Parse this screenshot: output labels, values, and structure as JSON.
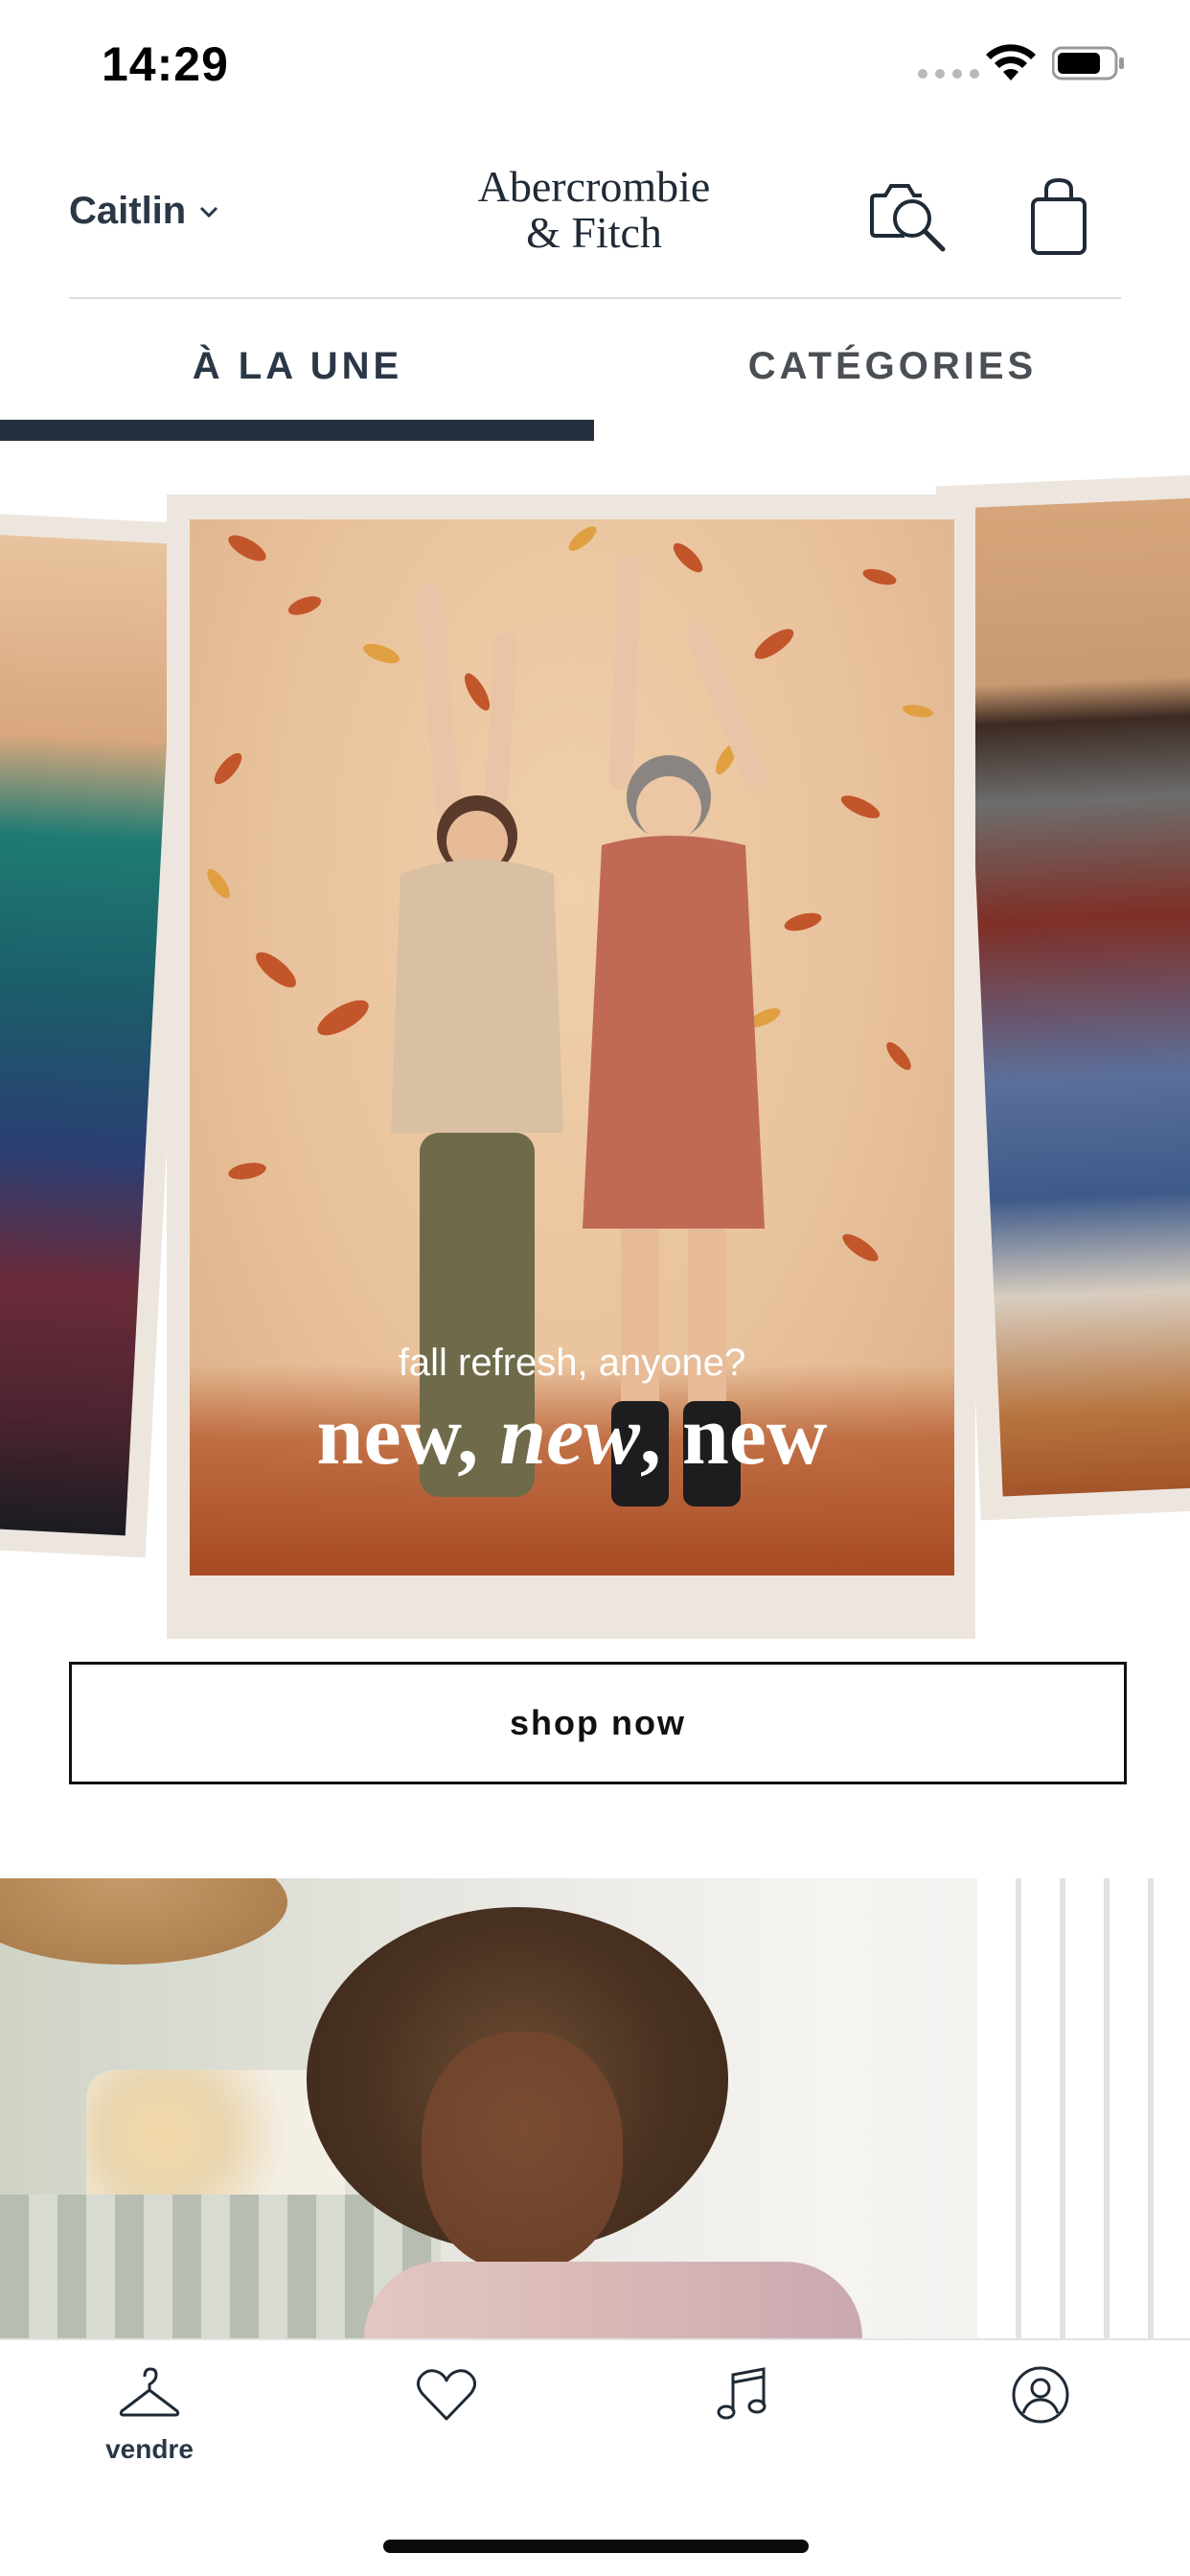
{
  "status_bar": {
    "time": "14:29",
    "icons": [
      "signal-icon",
      "wifi-icon",
      "battery-icon"
    ]
  },
  "header": {
    "user_name": "Caitlin",
    "logo_line1": "Abercrombie",
    "logo_line2": "& Fitch",
    "icons": [
      "chevron-down-icon",
      "visual-search-icon",
      "shopping-bag-icon"
    ]
  },
  "tabs": [
    {
      "label": "À LA UNE",
      "active": true
    },
    {
      "label": "CATÉGORIES",
      "active": false
    }
  ],
  "promo": {
    "subtitle": "fall refresh, anyone?",
    "title_part1": "new, ",
    "title_part2": "new",
    "title_part3": ", new",
    "button_label": "shop now"
  },
  "bottom_nav": [
    {
      "icon": "hanger-icon",
      "label": "vendre"
    },
    {
      "icon": "heart-icon",
      "label": ""
    },
    {
      "icon": "music-note-icon",
      "label": ""
    },
    {
      "icon": "account-icon",
      "label": ""
    }
  ],
  "colors": {
    "navy": "#24303d",
    "text": "#2a3747",
    "card_frame": "#ede6df"
  }
}
